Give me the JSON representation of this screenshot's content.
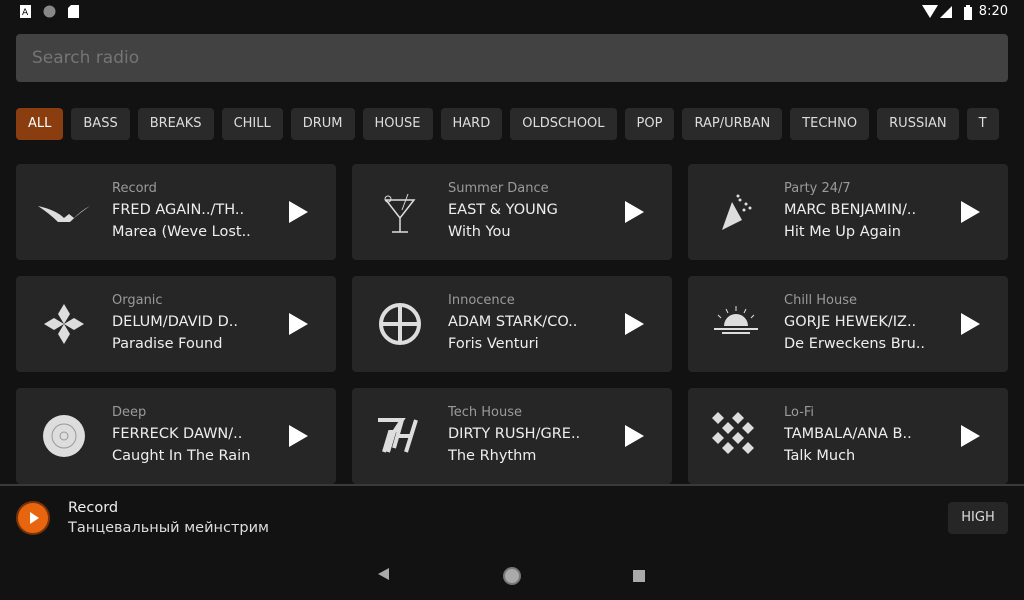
{
  "status_bar": {
    "time": "8:20",
    "icons": [
      "a-icon",
      "circle-icon",
      "sd-card-icon",
      "wifi-icon",
      "signal-icon",
      "battery-icon"
    ]
  },
  "search": {
    "placeholder": "Search radio",
    "value": ""
  },
  "chips": [
    "ALL",
    "BASS",
    "BREAKS",
    "CHILL",
    "DRUM",
    "HOUSE",
    "HARD",
    "OLDSCHOOL",
    "POP",
    "RAP/URBAN",
    "TECHNO",
    "RUSSIAN",
    "T"
  ],
  "active_chip": "ALL",
  "colors": {
    "accent": "#e8650f",
    "active_chip": "#8a3e10",
    "card": "#262626",
    "background": "#121212"
  },
  "stations": [
    {
      "genre": "Record",
      "artist": "FRED AGAIN../TH..",
      "title": "Marea (Weve Lost..",
      "icon": "record-wings-icon"
    },
    {
      "genre": "Summer Dance",
      "artist": "EAST & YOUNG",
      "title": "With You",
      "icon": "cocktail-icon"
    },
    {
      "genre": "Party 24/7",
      "artist": "MARC BENJAMIN/..",
      "title": "Hit Me Up Again",
      "icon": "party-popper-icon"
    },
    {
      "genre": "Organic",
      "artist": "DELUM/DAVID D..",
      "title": "Paradise Found",
      "icon": "flower-icon"
    },
    {
      "genre": "Innocence",
      "artist": "ADAM STARK/CO..",
      "title": "Foris Venturi",
      "icon": "circle-cross-icon"
    },
    {
      "genre": "Chill House",
      "artist": "GORJE HEWEK/IZ..",
      "title": "De Erweckens Bru..",
      "icon": "sunset-icon"
    },
    {
      "genre": "Deep",
      "artist": "FERRECK DAWN/..",
      "title": "Caught In The Rain",
      "icon": "vinyl-icon"
    },
    {
      "genre": "Tech House",
      "artist": "DIRTY RUSH/GRE..",
      "title": "The Rhythm",
      "icon": "th-logo-icon"
    },
    {
      "genre": "Lo-Fi",
      "artist": "TAMBALA/ANA B..",
      "title": "Talk Much",
      "icon": "checker-diamond-icon"
    }
  ],
  "player": {
    "station": "Record",
    "description": "Танцевальный мейнстрим",
    "quality": "HIGH"
  }
}
